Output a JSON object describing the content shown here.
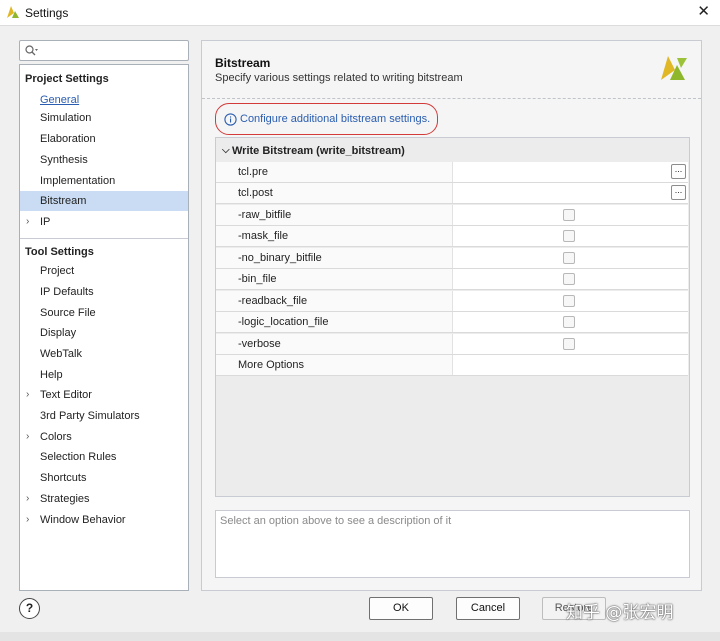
{
  "window": {
    "title": "Settings"
  },
  "search": {
    "placeholder": ""
  },
  "sidebar": {
    "project_header": "Project Settings",
    "project_items": [
      {
        "label": "General"
      },
      {
        "label": "Simulation"
      },
      {
        "label": "Elaboration"
      },
      {
        "label": "Synthesis"
      },
      {
        "label": "Implementation"
      },
      {
        "label": "Bitstream"
      },
      {
        "label": "IP"
      }
    ],
    "tool_header": "Tool Settings",
    "tool_items": [
      {
        "label": "Project"
      },
      {
        "label": "IP Defaults"
      },
      {
        "label": "Source File"
      },
      {
        "label": "Display"
      },
      {
        "label": "WebTalk"
      },
      {
        "label": "Help"
      },
      {
        "label": "Text Editor"
      },
      {
        "label": "3rd Party Simulators"
      },
      {
        "label": "Colors"
      },
      {
        "label": "Selection Rules"
      },
      {
        "label": "Shortcuts"
      },
      {
        "label": "Strategies"
      },
      {
        "label": "Window Behavior"
      }
    ]
  },
  "main": {
    "title": "Bitstream",
    "description": "Specify various settings related to writing bitstream",
    "config_link": "Configure additional bitstream settings.",
    "group_label": "Write Bitstream (write_bitstream)",
    "options": [
      {
        "name": "tcl.pre"
      },
      {
        "name": "tcl.post"
      },
      {
        "name": "-raw_bitfile"
      },
      {
        "name": "-mask_file"
      },
      {
        "name": "-no_binary_bitfile"
      },
      {
        "name": "-bin_file"
      },
      {
        "name": "-readback_file"
      },
      {
        "name": "-logic_location_file"
      },
      {
        "name": "-verbose"
      },
      {
        "name": "More Options"
      }
    ],
    "ellipsis_label": "...",
    "description_placeholder": "Select an option above to see a description of it"
  },
  "footer": {
    "help_label": "?",
    "ok_label": "OK",
    "cancel_label": "Cancel",
    "restore_label": "Restore",
    "watermark": "知乎 @张宏明"
  },
  "colors": {
    "accent_link": "#2a5db0",
    "selection": "#c9dcf3",
    "highlight_circle": "#d33a3a"
  }
}
